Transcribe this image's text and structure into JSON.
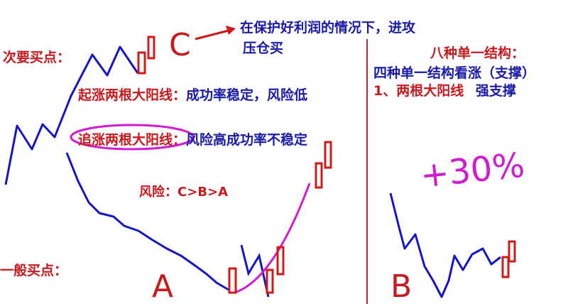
{
  "colors": {
    "red": "#c8191e",
    "blue": "#1a1aa8",
    "magenta": "#d21ad2",
    "line_blue": "#1515c8",
    "divider": "#a03030"
  },
  "left": {
    "note_line1": "在保护好利润的情况下，进攻",
    "note_line2": "压仓买",
    "secondary_buy_label": "次要买点：",
    "start_rise_label": "起涨两根大阳线：",
    "start_rise_desc": "成功率稳定，风险低",
    "chase_rise_label": "追涨两根大阳线：",
    "chase_rise_desc": "风险高成功率不稳定",
    "risk_text": "风险：C>B>A",
    "general_buy_label": "一般买点：",
    "letter_a": "A",
    "letter_c": "C"
  },
  "right": {
    "title": "八种单一结构：",
    "subtitle": "四种单一结构看涨（支撑）",
    "item1_red": "1、两根大阳线",
    "item1_blue": "强支撑",
    "gain": "+30%",
    "letter_b": "B"
  }
}
